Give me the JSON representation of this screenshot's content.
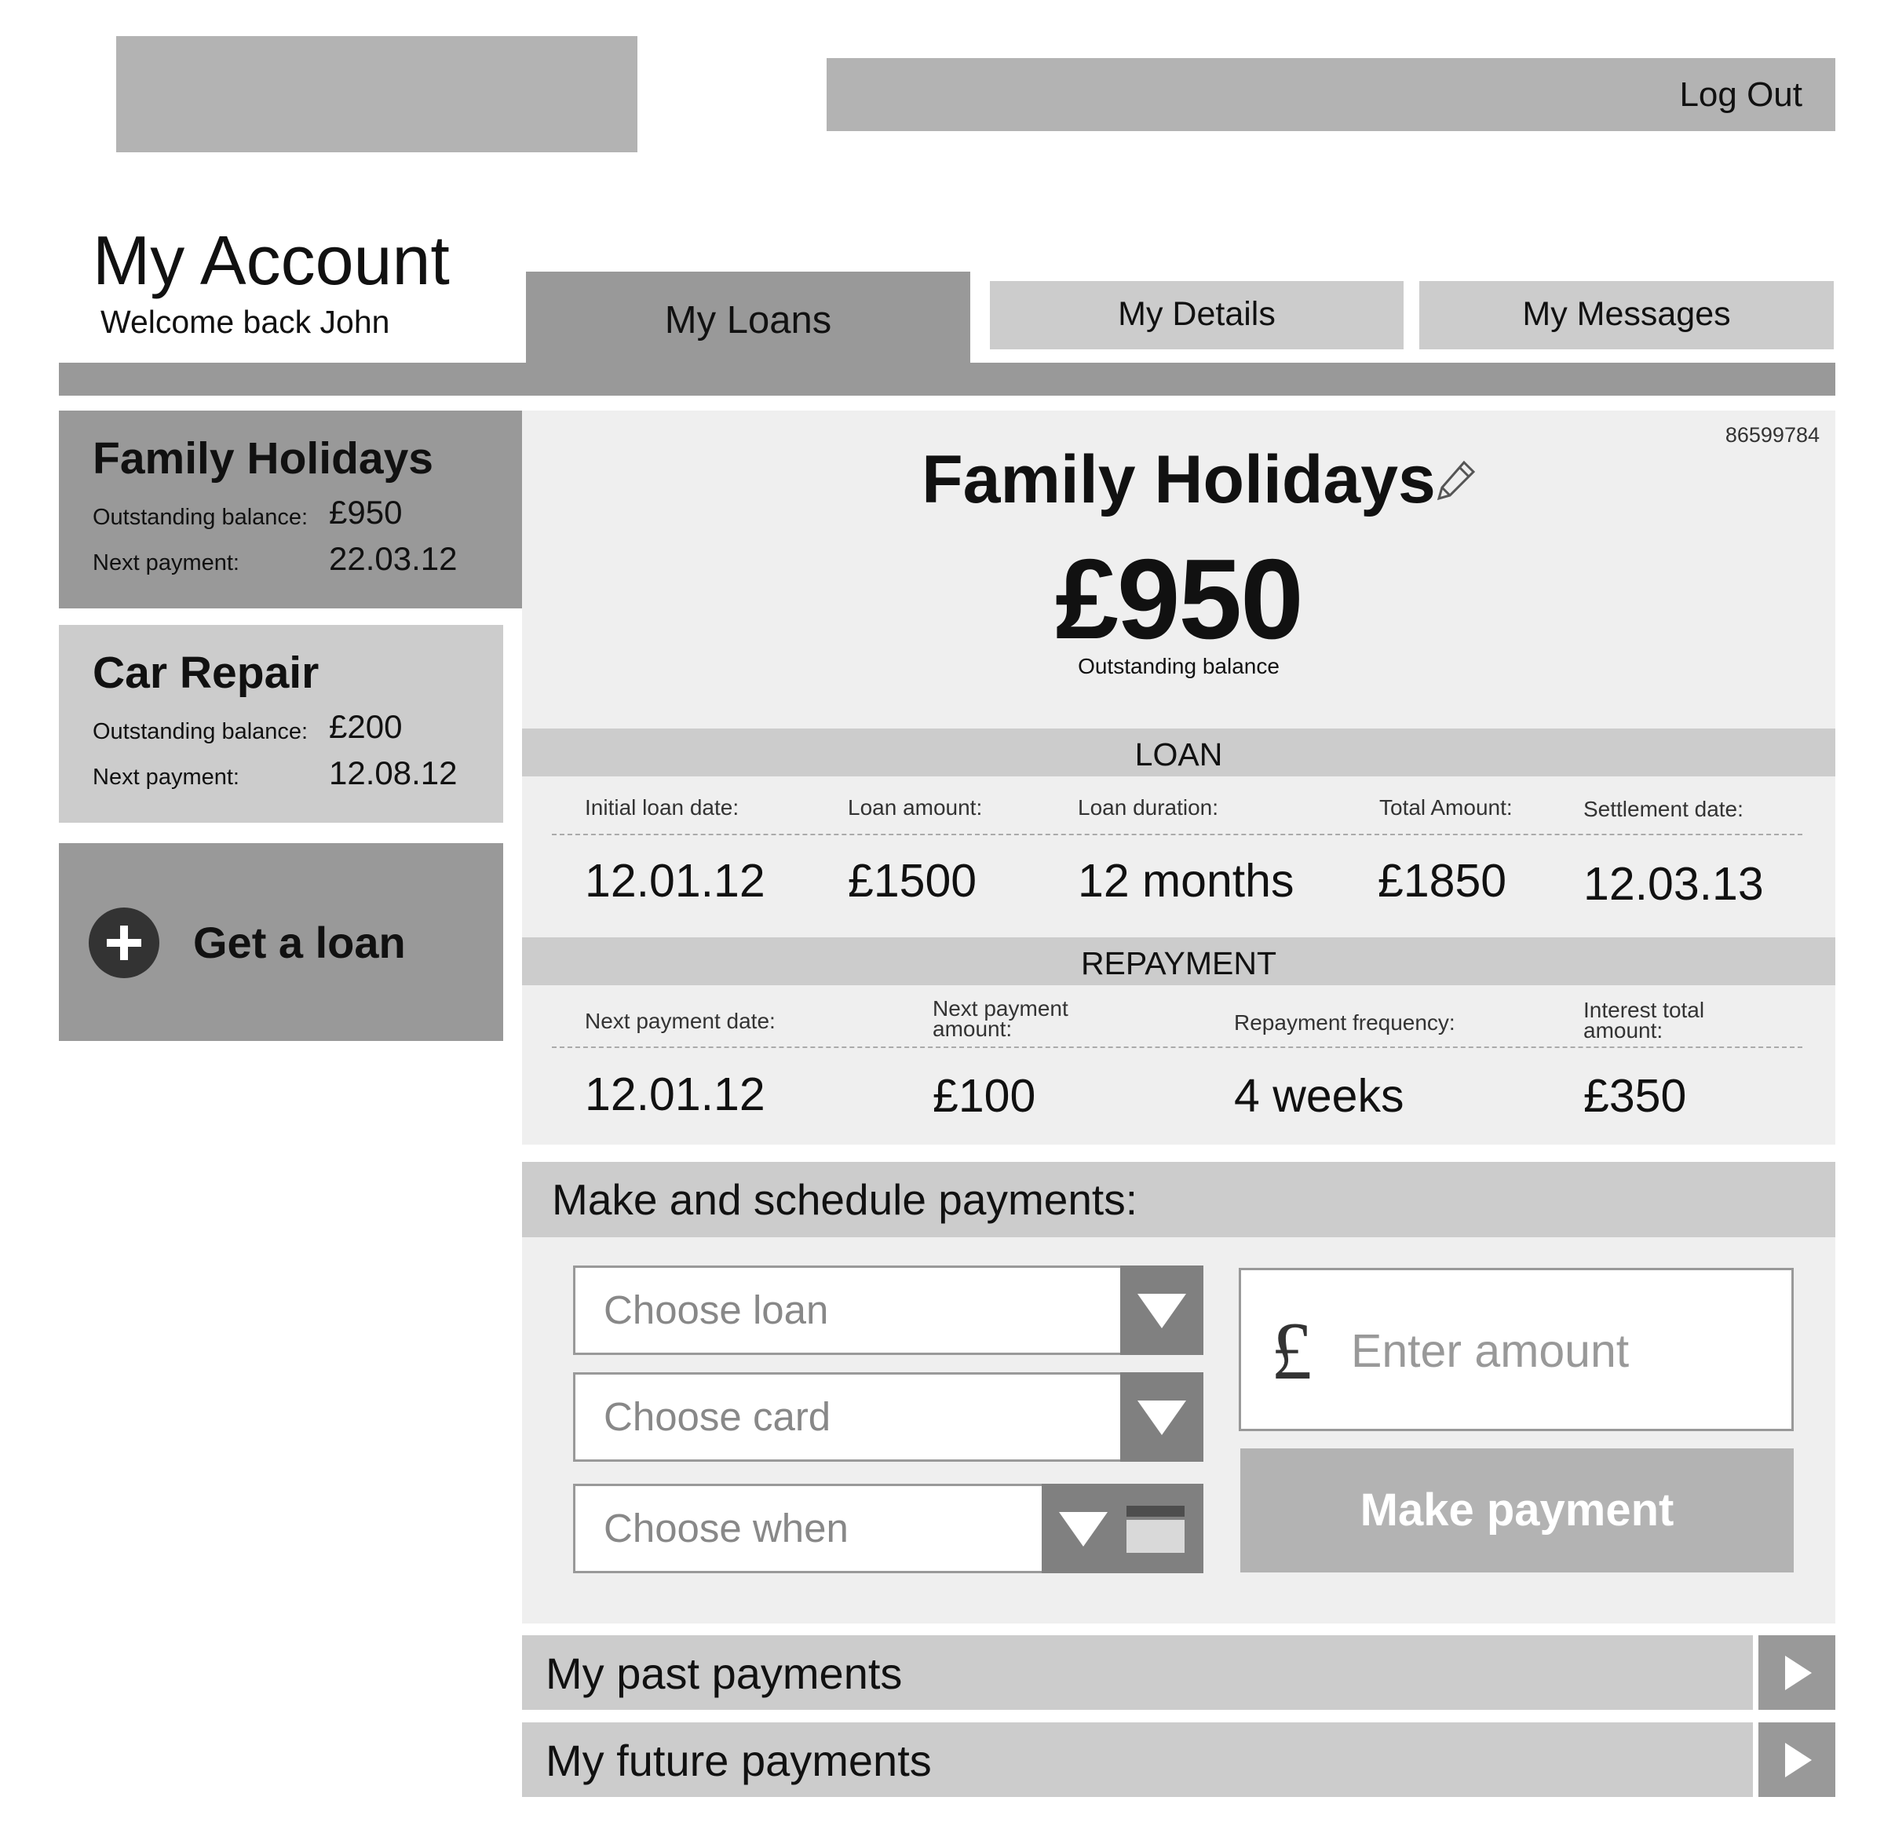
{
  "header": {
    "logout_label": "Log Out"
  },
  "account": {
    "title": "My Account",
    "welcome": "Welcome back John"
  },
  "tabs": [
    {
      "label": "My Loans",
      "active": true
    },
    {
      "label": "My Details",
      "active": false
    },
    {
      "label": "My Messages",
      "active": false
    }
  ],
  "sidebar": {
    "loans": [
      {
        "title": "Family Holidays",
        "balance_label": "Outstanding balance:",
        "balance": "£950",
        "next_label": "Next payment:",
        "next": "22.03.12",
        "selected": true
      },
      {
        "title": "Car Repair",
        "balance_label": "Outstanding balance:",
        "balance": "£200",
        "next_label": "Next payment:",
        "next": "12.08.12",
        "selected": false
      }
    ],
    "get_loan_label": "Get a loan",
    "get_loan_icon": "plus-circle-icon"
  },
  "loan_detail": {
    "account_number": "86599784",
    "title": "Family Holidays",
    "edit_icon": "pencil-icon",
    "balance": "£950",
    "balance_label": "Outstanding balance",
    "loan_section": {
      "header": "LOAN",
      "columns": [
        {
          "label": "Initial loan date:",
          "value": "12.01.12"
        },
        {
          "label": "Loan amount:",
          "value": "£1500"
        },
        {
          "label": "Loan duration:",
          "value": "12 months"
        },
        {
          "label": "Total Amount:",
          "value": "£1850"
        },
        {
          "label": "Settlement date:",
          "value": "12.03.13"
        }
      ]
    },
    "repayment_section": {
      "header": "REPAYMENT",
      "columns": [
        {
          "label": "Next payment date:",
          "value": "12.01.12"
        },
        {
          "label_line1": "Next payment",
          "label_line2": "amount:",
          "value": "£100"
        },
        {
          "label": "Repayment frequency:",
          "value": "4 weeks"
        },
        {
          "label_line1": "Interest total",
          "label_line2": "amount:",
          "value": "£350"
        }
      ]
    }
  },
  "payments": {
    "header": "Make and schedule payments:",
    "choose_loan_placeholder": "Choose loan",
    "choose_card_placeholder": "Choose card",
    "choose_when_placeholder": "Choose when",
    "currency_symbol": "£",
    "amount_placeholder": "Enter amount",
    "make_payment_label": "Make payment"
  },
  "history": {
    "past_label": "My past payments",
    "future_label": "My future payments"
  },
  "colors": {
    "dark_grey": "#999999",
    "mid_grey": "#b3b3b3",
    "light_grey": "#cccccc",
    "panel_bg": "#efefef"
  }
}
